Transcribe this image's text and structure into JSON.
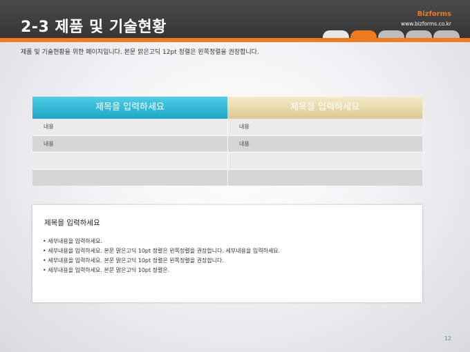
{
  "header": {
    "title": "2-3 제품 및 기술현황",
    "brand": "Bizforms",
    "url": "www.bizforms.co.kr",
    "tab_colors": [
      "#e6e6e6",
      "#f07a1e",
      "#bdbdbd",
      "#bdbdbd",
      "#bdbdbd"
    ]
  },
  "subtitle": "제품 및 기술현황을 위한 페이지입니다. 본문 맑은고딕 12pt 정렬은 왼쪽정렬을 권장합니다.",
  "table": {
    "headers": [
      "제목을 입력하세요",
      "제목을 입력하세요"
    ],
    "rows": [
      [
        "내용",
        "내용"
      ],
      [
        "내용",
        "내용"
      ],
      [
        "",
        ""
      ],
      [
        "",
        ""
      ]
    ]
  },
  "content_box": {
    "title": "제목을 입력하세요",
    "bullets": [
      "세부내용을 입력하세요.",
      "세부내용을 입력하세요. 본문 맑은고딕 10pt 정렬은 왼쪽정렬을 권장합니다. 세부내용을 입력하세요.",
      "세부내용을 입력하세요. 본문 맑은고딕 10pt 정렬은 왼쪽정렬을 권장합니다.",
      "세부내용을 입력하세요. 본문 맑은고딕 10pt 정렬은."
    ]
  },
  "page_number": "12",
  "colors": {
    "accent": "#f07a1e",
    "header_bg": "#3f3f3f",
    "table_header_left": "#2fb6d6",
    "table_header_right": "#e6d7a8"
  }
}
